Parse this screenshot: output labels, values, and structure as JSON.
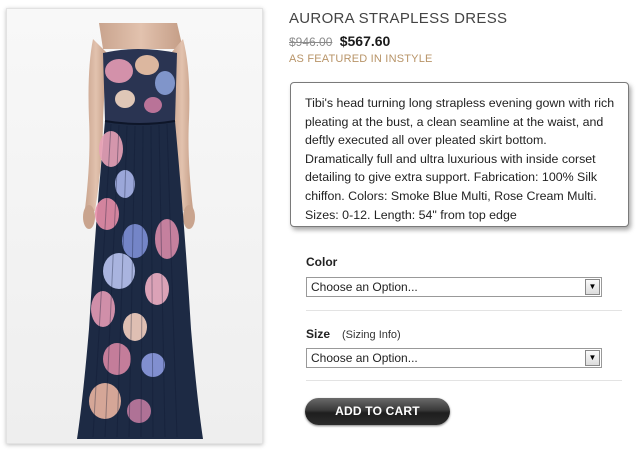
{
  "product": {
    "title": "AURORA STRAPLESS DRESS",
    "old_price": "$946.00",
    "new_price": "$567.60",
    "featured": "AS FEATURED IN INSTYLE",
    "description": "Tibi's head turning long strapless evening gown with rich pleating at the bust, a clean seamline at the waist, and deftly executed all over pleated skirt bottom. Dramatically full and ultra luxurious with inside corset detailing to give extra support. Fabrication: 100% Silk chiffon. Colors: Smoke Blue Multi, Rose Cream Multi. Sizes: 0-12. Length: 54\" from top edge"
  },
  "options": {
    "color": {
      "label": "Color",
      "selected": "Choose an Option..."
    },
    "size": {
      "label": "Size",
      "link": "(Sizing Info)",
      "selected": "Choose an Option..."
    }
  },
  "actions": {
    "add_to_cart": "ADD TO CART"
  },
  "image": {
    "subject": "model-in-floral-strapless-gown",
    "dress_base_color": "#1d2a44"
  }
}
